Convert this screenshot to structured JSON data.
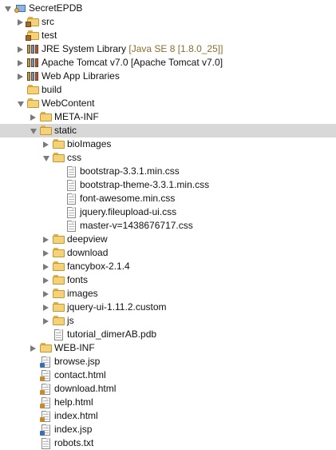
{
  "tree": [
    {
      "label": "SecretEPDB",
      "depth": 0,
      "state": "exp",
      "icon": "project-icon"
    },
    {
      "label": "src",
      "depth": 1,
      "state": "col",
      "icon": "source-folder-icon"
    },
    {
      "label": "test",
      "depth": 1,
      "state": "none",
      "icon": "source-folder-icon"
    },
    {
      "label": "JRE System Library",
      "deco": " [Java SE 8 [1.8.0_25]]",
      "depth": 1,
      "state": "col",
      "icon": "library-icon"
    },
    {
      "label": "Apache Tomcat v7.0 [Apache Tomcat v7.0]",
      "depth": 1,
      "state": "col",
      "icon": "library-icon"
    },
    {
      "label": "Web App Libraries",
      "depth": 1,
      "state": "col",
      "icon": "library-icon"
    },
    {
      "label": "build",
      "depth": 1,
      "state": "none",
      "icon": "folder-icon"
    },
    {
      "label": "WebContent",
      "depth": 1,
      "state": "exp",
      "icon": "folder-icon"
    },
    {
      "label": "META-INF",
      "depth": 2,
      "state": "col",
      "icon": "folder-icon"
    },
    {
      "label": "static",
      "depth": 2,
      "state": "exp",
      "icon": "folder-icon",
      "selected": true
    },
    {
      "label": "bioImages",
      "depth": 3,
      "state": "col",
      "icon": "folder-icon"
    },
    {
      "label": "css",
      "depth": 3,
      "state": "exp",
      "icon": "folder-icon"
    },
    {
      "label": "bootstrap-3.3.1.min.css",
      "depth": 4,
      "state": "none",
      "icon": "css-file-icon"
    },
    {
      "label": "bootstrap-theme-3.3.1.min.css",
      "depth": 4,
      "state": "none",
      "icon": "css-file-icon"
    },
    {
      "label": "font-awesome.min.css",
      "depth": 4,
      "state": "none",
      "icon": "css-file-icon"
    },
    {
      "label": "jquery.fileupload-ui.css",
      "depth": 4,
      "state": "none",
      "icon": "css-file-icon"
    },
    {
      "label": "master-v=1438676717.css",
      "depth": 4,
      "state": "none",
      "icon": "css-file-icon"
    },
    {
      "label": "deepview",
      "depth": 3,
      "state": "col",
      "icon": "folder-icon"
    },
    {
      "label": "download",
      "depth": 3,
      "state": "col",
      "icon": "folder-icon"
    },
    {
      "label": "fancybox-2.1.4",
      "depth": 3,
      "state": "col",
      "icon": "folder-icon"
    },
    {
      "label": "fonts",
      "depth": 3,
      "state": "col",
      "icon": "folder-icon"
    },
    {
      "label": "images",
      "depth": 3,
      "state": "col",
      "icon": "folder-icon"
    },
    {
      "label": "jquery-ui-1.11.2.custom",
      "depth": 3,
      "state": "col",
      "icon": "folder-icon"
    },
    {
      "label": "js",
      "depth": 3,
      "state": "col",
      "icon": "folder-icon"
    },
    {
      "label": "tutorial_dimerAB.pdb",
      "depth": 3,
      "state": "none",
      "icon": "file-icon"
    },
    {
      "label": "WEB-INF",
      "depth": 2,
      "state": "col",
      "icon": "folder-icon"
    },
    {
      "label": "browse.jsp",
      "depth": 2,
      "state": "none",
      "icon": "jsp-file-icon"
    },
    {
      "label": "contact.html",
      "depth": 2,
      "state": "none",
      "icon": "html-file-icon"
    },
    {
      "label": "download.html",
      "depth": 2,
      "state": "none",
      "icon": "html-file-icon"
    },
    {
      "label": "help.html",
      "depth": 2,
      "state": "none",
      "icon": "html-file-icon"
    },
    {
      "label": "index.html",
      "depth": 2,
      "state": "none",
      "icon": "html-file-icon"
    },
    {
      "label": "index.jsp",
      "depth": 2,
      "state": "none",
      "icon": "jsp-file-icon"
    },
    {
      "label": "robots.txt",
      "depth": 2,
      "state": "none",
      "icon": "text-file-icon"
    }
  ]
}
